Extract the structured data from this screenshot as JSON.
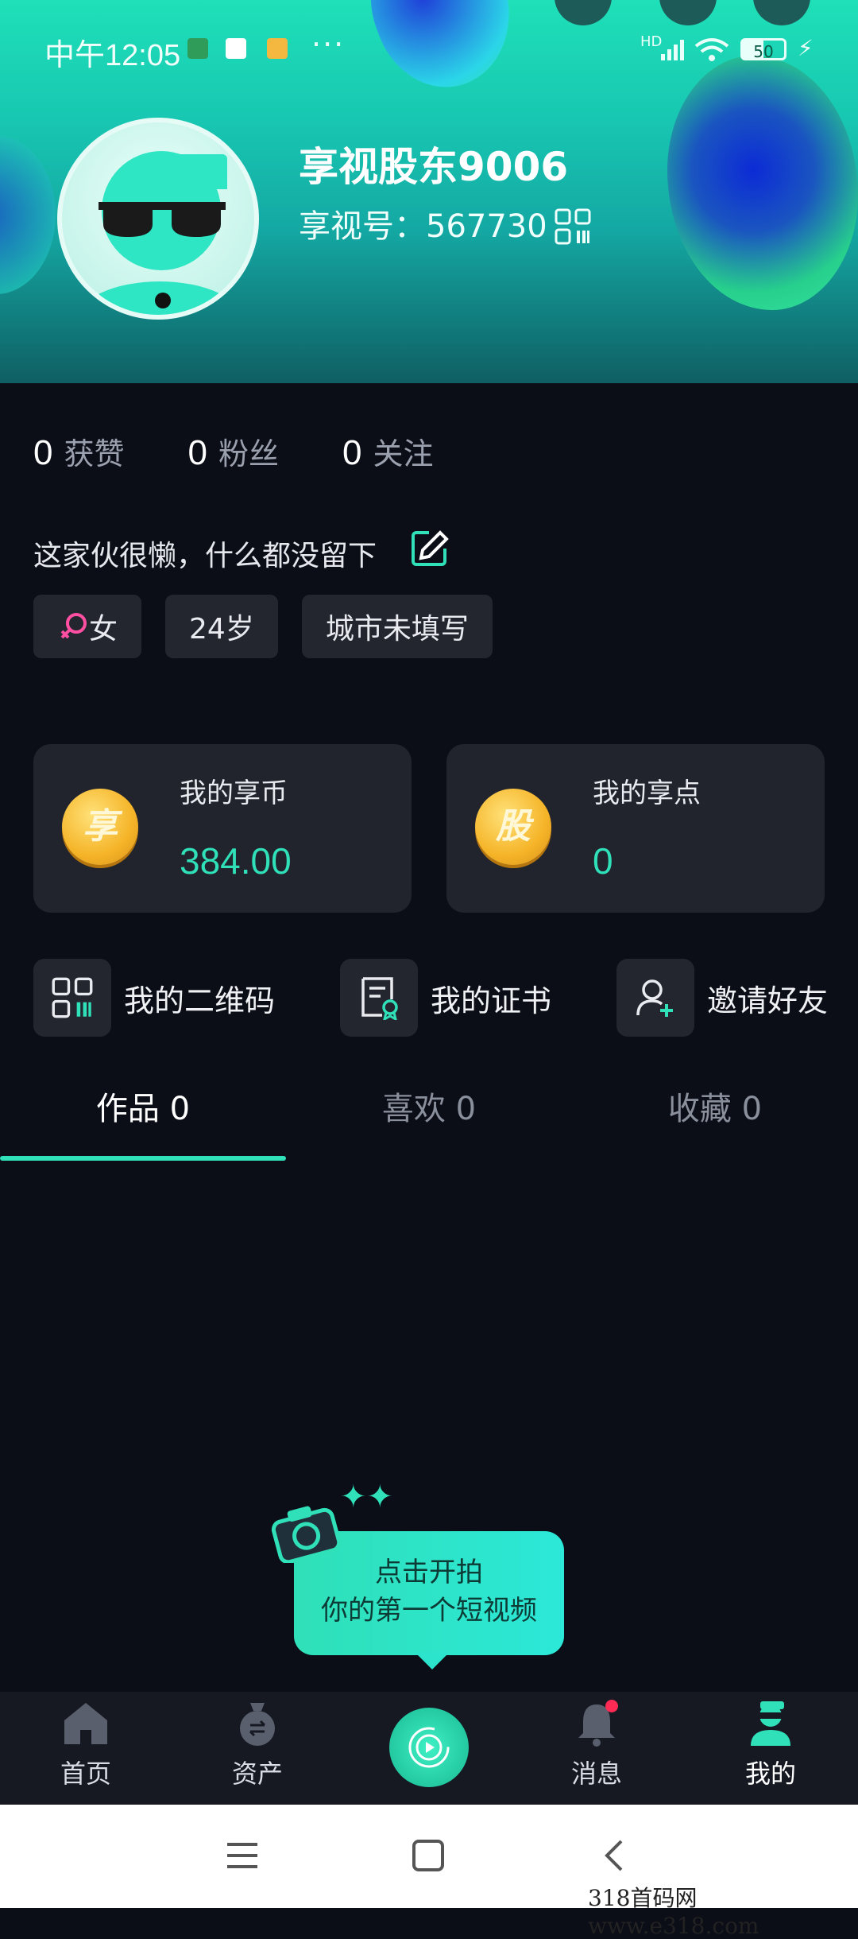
{
  "status": {
    "time": "中午12:05",
    "dots": "···",
    "signal": "HD",
    "battery": "50"
  },
  "profile": {
    "name": "享视股东9006",
    "uid": "享视号：567730"
  },
  "counts": [
    {
      "value": "0",
      "label": "获赞"
    },
    {
      "value": "0",
      "label": "粉丝"
    },
    {
      "value": "0",
      "label": "关注"
    }
  ],
  "bio": "这家伙很懒，什么都没留下",
  "tags": {
    "gender": "女",
    "age": "24岁",
    "city": "城市未填写"
  },
  "wallet": {
    "coins": {
      "title": "我的享币",
      "value": "384.00",
      "badge": "享"
    },
    "points": {
      "title": "我的享点",
      "value": "0",
      "badge": "股"
    }
  },
  "shortcuts": {
    "qr": "我的二维码",
    "cert": "我的证书",
    "invite": "邀请好友"
  },
  "tabs": {
    "works": "作品 0",
    "likes": "喜欢 0",
    "favorites": "收藏 0"
  },
  "cta": {
    "line1": "点击开拍",
    "line2": "你的第一个短视频"
  },
  "nav": {
    "home": "首页",
    "assets": "资产",
    "messages": "消息",
    "mine": "我的"
  },
  "watermark": "318首码网  www.e318.com",
  "colors": {
    "accent": "#2fe0b8",
    "background": "#0b0d17",
    "card": "#21232d"
  }
}
